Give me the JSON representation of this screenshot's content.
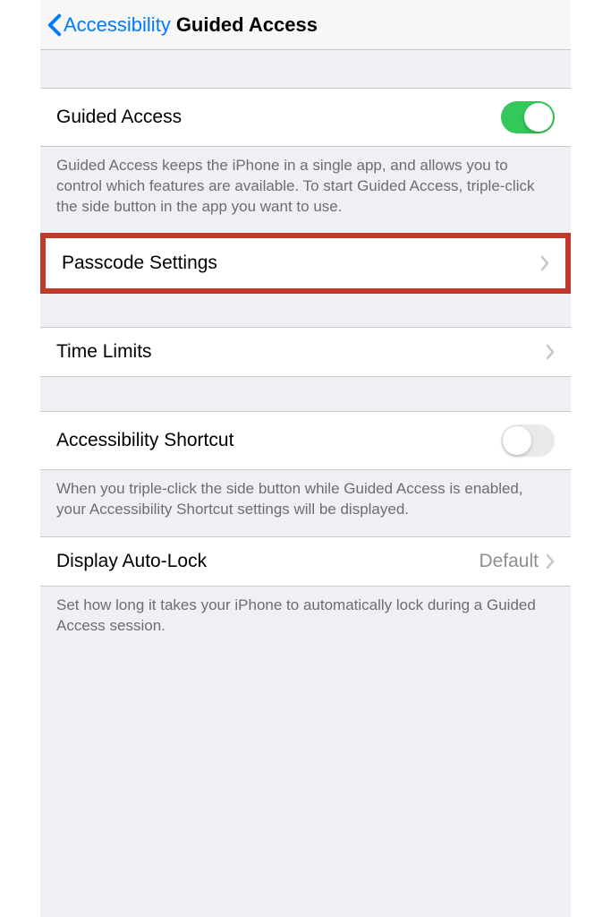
{
  "nav": {
    "back_label": "Accessibility",
    "title": "Guided Access"
  },
  "sections": {
    "guided_access": {
      "label": "Guided Access",
      "enabled": true,
      "footer": "Guided Access keeps the iPhone in a single app, and allows you to control which features are available. To start Guided Access, triple-click the side button in the app you want to use."
    },
    "passcode": {
      "label": "Passcode Settings"
    },
    "time_limits": {
      "label": "Time Limits"
    },
    "accessibility_shortcut": {
      "label": "Accessibility Shortcut",
      "enabled": false,
      "footer": "When you triple-click the side button while Guided Access is enabled, your Accessibility Shortcut settings will be displayed."
    },
    "display_auto_lock": {
      "label": "Display Auto-Lock",
      "value": "Default",
      "footer": "Set how long it takes your iPhone to automatically lock during a Guided Access session."
    }
  }
}
